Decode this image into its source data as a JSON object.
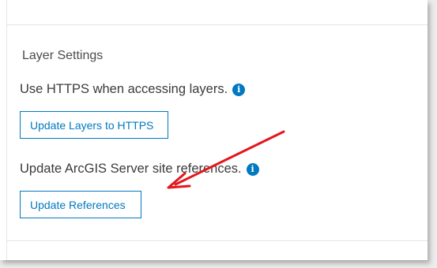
{
  "section": {
    "heading": "Layer Settings"
  },
  "https": {
    "label": "Use HTTPS when accessing layers.",
    "button_label": "Update Layers to HTTPS"
  },
  "references": {
    "label": "Update ArcGIS Server site references.",
    "button_label": "Update References"
  },
  "icons": {
    "info_glyph": "i"
  },
  "colors": {
    "accent": "#0079c1",
    "annotation_arrow": "#e4161c"
  }
}
